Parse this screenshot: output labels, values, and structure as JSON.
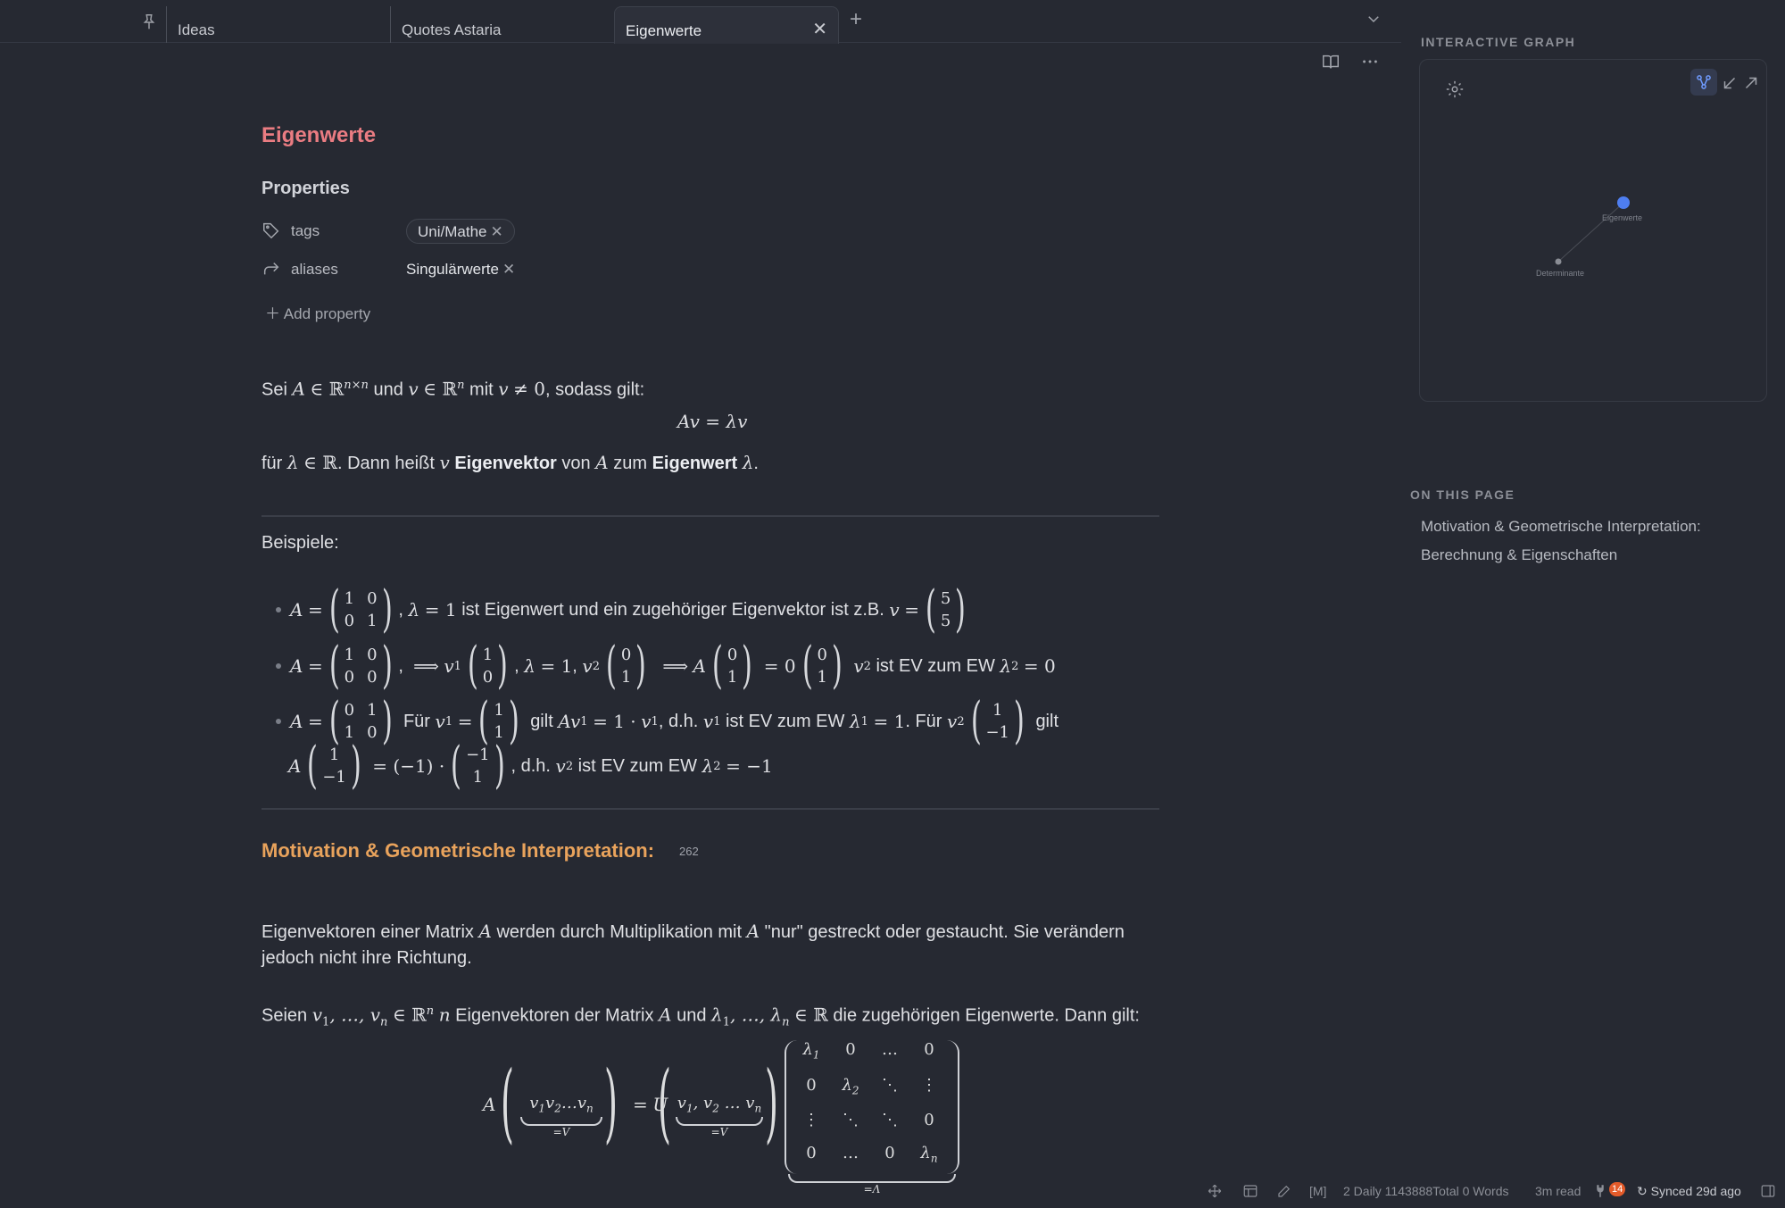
{
  "tabs": [
    {
      "label": "Ideas"
    },
    {
      "label": "Quotes Astaria"
    },
    {
      "label": "Eigenwerte"
    }
  ],
  "note": {
    "title": "Eigenwerte",
    "properties_heading": "Properties",
    "properties": [
      {
        "name": "tags",
        "value": "Uni/Mathe"
      },
      {
        "name": "aliases",
        "value": "Singulärwerte"
      }
    ],
    "add_property": "Add property"
  },
  "body": {
    "intro_sei": "Sei",
    "intro_und": "und",
    "intro_mit": "mit",
    "intro_sodass": ", sodass gilt:",
    "eq_main": "Av = λv",
    "fuer": "für",
    "dann_heisst": ". Dann heißt",
    "eigenvektor": "Eigenvektor",
    "von": "von",
    "zum": "zum",
    "eigenwert": "Eigenwert",
    "beispiele": "Beispiele:",
    "ex1_text": "ist Eigenwert und ein zugehöriger Eigenvektor ist z.B.",
    "ex2_text": "ist EV zum EW",
    "ex3_fuer": "Für",
    "ex3_gilt": "gilt",
    "ex3_dh": ", d.h.",
    "ex3_isev": "ist EV zum EW",
    "ex3_fuer2": ". Für",
    "ex3_gilt2": "gilt",
    "ex3b_dh": ", d.h.",
    "ex3b_isev": "ist EV zum EW"
  },
  "section_motivation": {
    "heading": "Motivation & Geometrische Interpretation:",
    "count": "262",
    "p1a": "Eigenvektoren einer Matrix",
    "p1b": "werden durch Multiplikation mit",
    "p1c": "\"nur\" gestreckt oder gestaucht. Sie verändern",
    "p1d": "jedoch nicht ihre Richtung.",
    "p2a": "Seien",
    "p2b": "Eigenvektoren der Matrix",
    "p2c": "und",
    "p2d": "die zugehörigen Eigenwerte. Dann gilt:"
  },
  "sidebar": {
    "graph_heading": "INTERACTIVE GRAPH",
    "graph_nodes": [
      {
        "label": "Eigenwerte",
        "color": "#4e7ef0"
      },
      {
        "label": "Determinante",
        "color": "#8a8d95"
      }
    ],
    "toc_heading": "ON THIS PAGE",
    "toc": [
      {
        "label": "Motivation & Geometrische Interpretation:"
      },
      {
        "label": "Berechnung & Eigenschaften"
      }
    ]
  },
  "statusbar": {
    "mode": "[M]",
    "daily": "2 Daily 1143888Total 0 Words",
    "read": "3m read",
    "badge": "14",
    "sync": "Synced 29d ago"
  },
  "colors": {
    "title": "#ea7c82",
    "heading2": "#e9a35c",
    "accent": "#4e7ef0"
  }
}
